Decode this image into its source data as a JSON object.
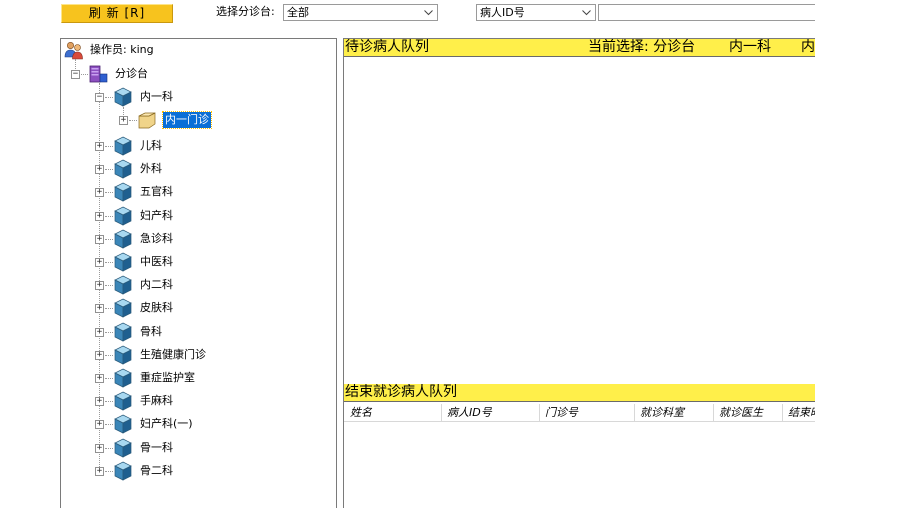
{
  "toolbar": {
    "refresh_label": "刷 新 [R]",
    "triage_label": "选择分诊台:",
    "triage_value": "全部",
    "search_type_value": "病人ID号",
    "search_input_value": ""
  },
  "tree": {
    "operator": "操作员: king",
    "root": "分诊台",
    "dept_expanded": "内一科",
    "clinic_selected": "内一门诊",
    "departments": [
      "儿科",
      "外科",
      "五官科",
      "妇产科",
      "急诊科",
      "中医科",
      "内二科",
      "皮肤科",
      "骨科",
      "生殖健康门诊",
      "重症监护室",
      "手麻科",
      "妇产科(一)",
      "骨一科",
      "骨二科"
    ]
  },
  "waiting_queue": {
    "title": "待诊病人队列",
    "current_selection": "当前选择: 分诊台",
    "sel_dept": "内一科",
    "sel_clinic_partial": "内"
  },
  "finished_queue": {
    "title": "结束就诊病人队列",
    "columns": [
      "姓名",
      "病人ID号",
      "门诊号",
      "就诊科室",
      "就诊医生",
      "结束时"
    ]
  }
}
